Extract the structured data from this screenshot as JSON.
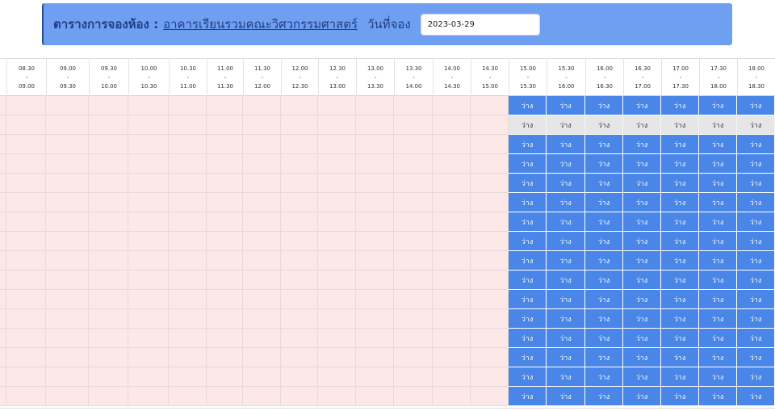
{
  "header": {
    "title": "ตารางการจองห้อง :",
    "building": "อาคารเรียนรวมคณะวิศวกรรมศาสตร์",
    "date_label": "วันที่จอง",
    "date_value": "2023-03-29"
  },
  "time_slots": [
    {
      "start": "08.30",
      "end": "09.00"
    },
    {
      "start": "09.00",
      "end": "09.30"
    },
    {
      "start": "09.30",
      "end": "10.00"
    },
    {
      "start": "10.00",
      "end": "10.30"
    },
    {
      "start": "10.30",
      "end": "11.00"
    },
    {
      "start": "11.00",
      "end": "11.30"
    },
    {
      "start": "11.30",
      "end": "12.00"
    },
    {
      "start": "12.00",
      "end": "12.30"
    },
    {
      "start": "12.30",
      "end": "13.00"
    },
    {
      "start": "13.00",
      "end": "13.30"
    },
    {
      "start": "13.30",
      "end": "14.00"
    },
    {
      "start": "14.00",
      "end": "14.30"
    },
    {
      "start": "14.30",
      "end": "15.00"
    },
    {
      "start": "15.00",
      "end": "15.30"
    },
    {
      "start": "15.30",
      "end": "16.00"
    },
    {
      "start": "16.00",
      "end": "16.30"
    },
    {
      "start": "16.30",
      "end": "17.00"
    },
    {
      "start": "17.00",
      "end": "17.30"
    },
    {
      "start": "17.30",
      "end": "18.00"
    },
    {
      "start": "18.00",
      "end": "18.30"
    }
  ],
  "separator": "-",
  "slot_label": "ว่าง",
  "row_count": 16,
  "past_slot_count": 13,
  "unavailable_rows": [
    1
  ],
  "colors": {
    "header_bg": "#6f9ff0",
    "title": "#1e3f87",
    "free_slot": "#4a86e8",
    "past_slot": "#fde8e8",
    "unavailable_slot": "#e6e6e6"
  }
}
